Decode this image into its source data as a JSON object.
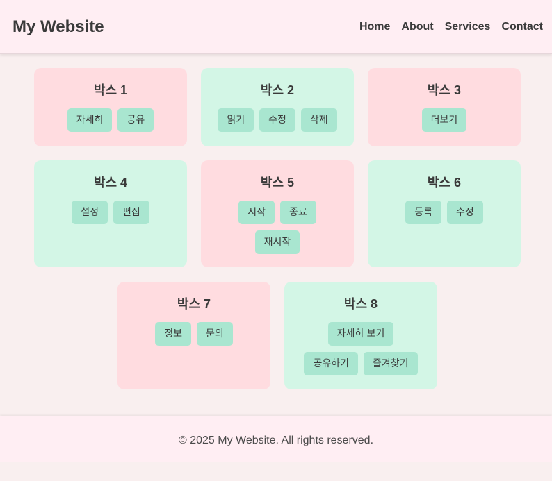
{
  "header": {
    "site_title": "My Website",
    "nav": [
      "Home",
      "About",
      "Services",
      "Contact"
    ]
  },
  "boxes": [
    {
      "title": "박스 1",
      "theme": "pink",
      "buttons": [
        "자세히",
        "공유"
      ]
    },
    {
      "title": "박스 2",
      "theme": "mint",
      "buttons": [
        "읽기",
        "수정",
        "삭제"
      ]
    },
    {
      "title": "박스 3",
      "theme": "pink",
      "buttons": [
        "더보기"
      ]
    },
    {
      "title": "박스 4",
      "theme": "mint",
      "buttons": [
        "설정",
        "편집"
      ]
    },
    {
      "title": "박스 5",
      "theme": "pink",
      "buttons": [
        "시작",
        "종료",
        "재시작"
      ]
    },
    {
      "title": "박스 6",
      "theme": "mint",
      "buttons": [
        "등록",
        "수정"
      ]
    },
    {
      "title": "박스 7",
      "theme": "pink",
      "buttons": [
        "정보",
        "문의"
      ]
    },
    {
      "title": "박스 8",
      "theme": "mint",
      "buttons": [
        "자세히 보기",
        "공유하기",
        "즐겨찾기"
      ]
    }
  ],
  "footer": {
    "copyright": "© 2025 My Website. All rights reserved."
  },
  "colors": {
    "page_background": "#f9efef",
    "header_background": "#ffeef3",
    "box_pink": "#ffdce0",
    "box_mint": "#d3f6e6",
    "button": "#a9e6d0",
    "text": "#3a3a3a"
  }
}
